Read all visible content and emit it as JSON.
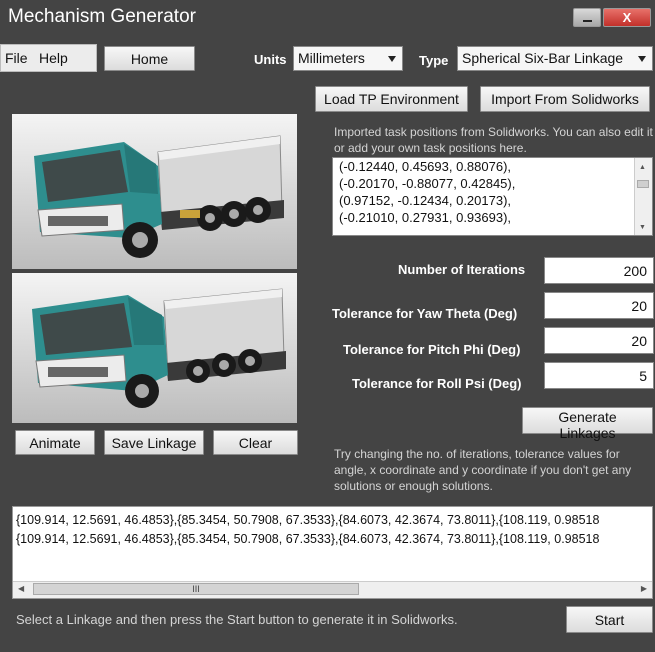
{
  "window": {
    "title": "Mechanism Generator",
    "close_label": "X"
  },
  "menu": {
    "file": "File",
    "help": "Help"
  },
  "toolbar": {
    "home": "Home",
    "units_label": "Units",
    "units_value": "Millimeters",
    "type_label": "Type",
    "type_value": "Spherical Six-Bar Linkage"
  },
  "actions": {
    "load_tp": "Load TP Environment",
    "import_sw": "Import From Solidworks",
    "animate": "Animate",
    "save_linkage": "Save Linkage",
    "clear": "Clear",
    "generate": "Generate Linkages",
    "start": "Start"
  },
  "task_positions": {
    "info": "Imported task positions from Solidworks. You can also edit it or add your own task positions here.",
    "rows": [
      "(-0.12440, 0.45693, 0.88076),",
      "(-0.20170, -0.88077, 0.42845),",
      "(0.97152, -0.12434, 0.20173),",
      "(-0.21010, 0.27931, 0.93693),"
    ]
  },
  "params": [
    {
      "label": "Number of Iterations",
      "value": "200"
    },
    {
      "label": "Tolerance for Yaw Theta (Deg)",
      "value": "20"
    },
    {
      "label": "Tolerance for Pitch Phi (Deg)",
      "value": "20"
    },
    {
      "label": "Tolerance for Roll Psi (Deg)",
      "value": "5"
    }
  ],
  "hint": "Try changing the no. of iterations, tolerance values for angle, x coordinate and y coordinate if you don't get any solutions or enough solutions.",
  "results": [
    "{109.914, 12.5691, 46.4853},{85.3454, 50.7908, 67.3533},{84.6073, 42.3674, 73.8011},{108.119, 0.98518",
    "{109.914, 12.5691, 46.4853},{85.3454, 50.7908, 67.3533},{84.6073, 42.3674, 73.8011},{108.119, 0.98518"
  ],
  "scroll_thumb": "III",
  "status": "Select a Linkage and then press the Start button to generate it in Solidworks.",
  "colors": {
    "background": "#444444",
    "truck_cab": "#2e8e8e"
  }
}
